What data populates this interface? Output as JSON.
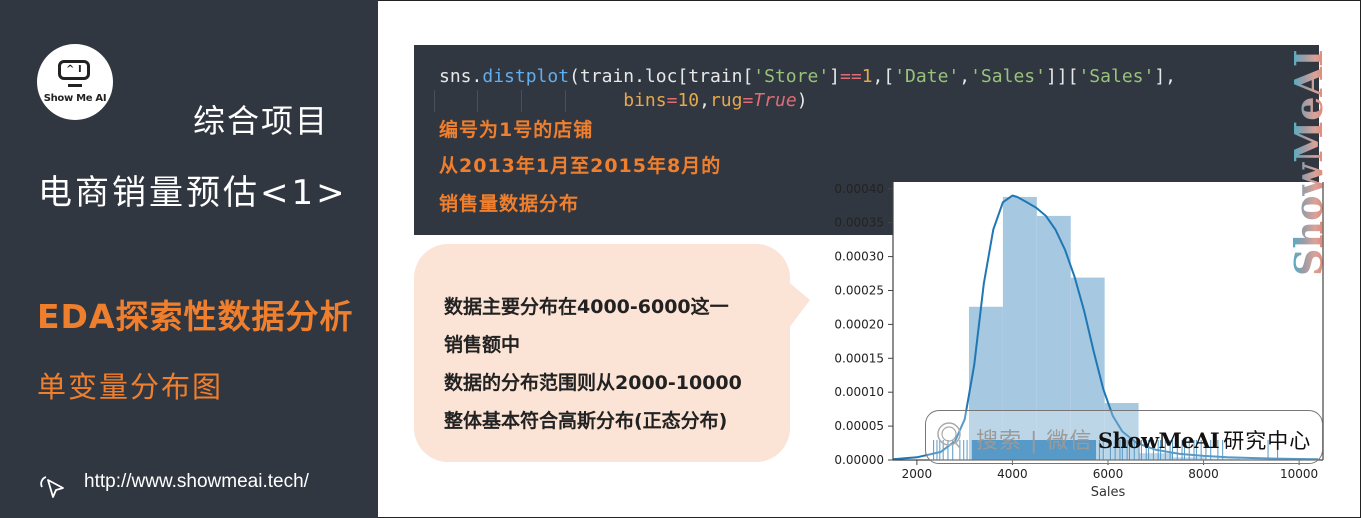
{
  "sidebar": {
    "logo_text": "Show Me AI",
    "logo_screen_glyphs": "^ I",
    "title_line1": "综合项目",
    "title_line2": "电商销量预估<1>",
    "section": "EDA探索性数据分析",
    "subsection": "单变量分布图",
    "url": "http://www.showmeai.tech/",
    "url_icon": "cursor-click-icon"
  },
  "code": {
    "line1_parts": [
      "sns",
      ".",
      "distplot",
      "(train.loc[train[",
      "'Store'",
      "]",
      "==",
      "1",
      ",[",
      "'Date'",
      ",",
      "'Sales'",
      "]][",
      "'Sales'",
      "],"
    ],
    "line2_parts": [
      "bins",
      "=",
      "10",
      ",",
      "rug",
      "=",
      "True",
      ")"
    ],
    "notes": [
      "编号为1号的店铺",
      "从2013年1月至2015年8月的",
      "销售量数据分布"
    ]
  },
  "callout": {
    "lines": [
      "数据主要分布在4000-6000这一",
      "销售额中",
      "数据的分布范围则从2000-10000",
      "整体基本符合高斯分布(正态分布)"
    ]
  },
  "watermark": {
    "vertical_text": "ShowMeAI",
    "search_label": "搜索 | 微信",
    "brand": "ShowMeAI",
    "brand_suffix": "研究中心"
  },
  "chart_data": {
    "type": "bar",
    "title": "",
    "xlabel": "Sales",
    "ylabel": "",
    "xlim": [
      1500,
      10500
    ],
    "ylim": [
      0,
      0.00041
    ],
    "xticks": [
      2000,
      4000,
      6000,
      8000,
      10000
    ],
    "xtick_labels": [
      "2000",
      "4000",
      "6000",
      "8000",
      "10000"
    ],
    "yticks": [
      0,
      5e-05,
      0.0001,
      0.00015,
      0.0002,
      0.00025,
      0.0003,
      0.00035,
      0.0004
    ],
    "ytick_labels": [
      "0.00000",
      "0.00005",
      "0.00010",
      "0.00015",
      "0.00020",
      "0.00025",
      "0.00030",
      "0.00035",
      "0.00040"
    ],
    "histogram": {
      "bin_edges": [
        3090,
        3800,
        4510,
        5220,
        5930,
        6640,
        7350,
        8060,
        8770,
        9480,
        10190
      ],
      "density": [
        0.000226,
        0.000388,
        0.00036,
        0.000269,
        8.4e-05,
        1e-05,
        4e-06,
        2e-06,
        1e-06,
        1e-06
      ],
      "color": "#a6c8e1"
    },
    "kde": {
      "x": [
        1500,
        2000,
        2500,
        2800,
        3000,
        3200,
        3400,
        3600,
        3800,
        4000,
        4100,
        4300,
        4500,
        4700,
        4900,
        5100,
        5300,
        5500,
        5700,
        5900,
        6100,
        6300,
        6600,
        7000,
        7500,
        8000,
        8500,
        9000,
        9500,
        10000,
        10400
      ],
      "y": [
        1e-06,
        4e-06,
        1.2e-05,
        2.8e-05,
        6e-05,
        0.00014,
        0.00026,
        0.00034,
        0.00038,
        0.00039,
        0.000388,
        0.00038,
        0.000372,
        0.00036,
        0.00034,
        0.00031,
        0.00027,
        0.00022,
        0.00016,
        0.000105,
        6.5e-05,
        4.2e-05,
        2.5e-05,
        1.5e-05,
        9e-06,
        6e-06,
        4e-06,
        3e-06,
        2e-06,
        1.5e-06,
        1e-06
      ],
      "color": "#1f77b4"
    },
    "rug": {
      "color": "#1f77b4",
      "dense_range": [
        3150,
        5750
      ],
      "sparse_values": [
        2350,
        2420,
        2480,
        2550,
        2650,
        2750,
        2900,
        2980,
        3050,
        5820,
        5900,
        6050,
        6150,
        6250,
        6300,
        6400,
        6450,
        6550,
        6650,
        6700,
        6800,
        6850,
        6950,
        7050,
        7100,
        7200,
        7300,
        7350,
        7450,
        7550,
        7600,
        7700,
        7800,
        7850,
        7950,
        8050,
        8150,
        8300,
        8400,
        9350,
        9550
      ]
    },
    "grid": false,
    "legend": "none"
  }
}
